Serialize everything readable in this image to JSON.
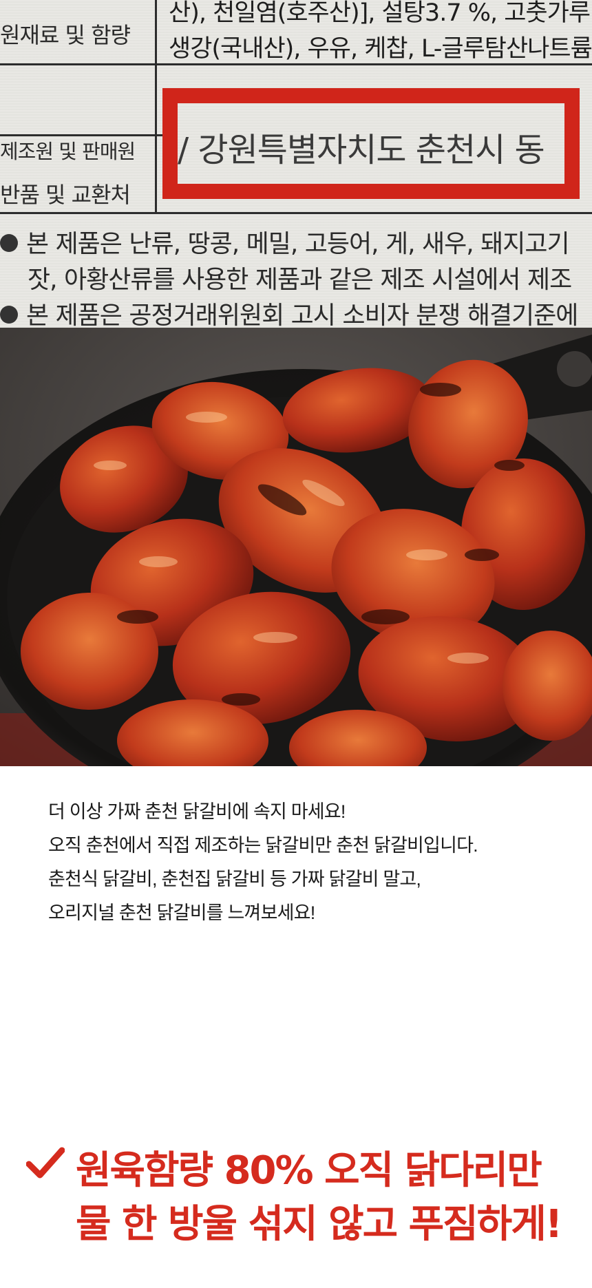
{
  "label_photo": {
    "rows": [
      {
        "label": "원재료 및 함량",
        "text_line1": "산), 천일염(호주산)], 설탕3.7 %, 고춧가루",
        "text_line2": "생강(국내산), 우유, 케찹, L-글루탐산나트륨"
      },
      {
        "label": "제조원 및 판매원",
        "text": "/ 강원특별자치도 춘천시 동"
      },
      {
        "label": "반품 및 교환처",
        "text": ""
      }
    ],
    "notes": [
      "본 제품은 난류, 땅콩, 메밀, 고등어, 게, 새우, 돼지고기",
      "잣, 아황산류를 사용한 제품과 같은 제조 시설에서 제조",
      "본 제품은 공정거래위원회 고시 소비자 분쟁 해결기준에"
    ],
    "highlight_color": "#d0251a"
  },
  "food_photo": {
    "subject": "spicy chicken galbi pieces in a black cast-iron skillet"
  },
  "description": {
    "lines": [
      "더 이상 가짜 춘천 닭갈비에 속지 마세요!",
      "오직 춘천에서 직접 제조하는 닭갈비만 춘천 닭갈비입니다.",
      "춘천식 닭갈비, 춘천집 닭갈비 등 가짜 닭갈비 말고,",
      "오리지널 춘천 닭갈비를 느껴보세요!"
    ]
  },
  "headline": {
    "line1": "원육함량 80% 오직 닭다리만",
    "line2": "물 한 방울 섞지 않고 푸짐하게!",
    "color": "#d52b1e",
    "icon": "check-icon"
  }
}
